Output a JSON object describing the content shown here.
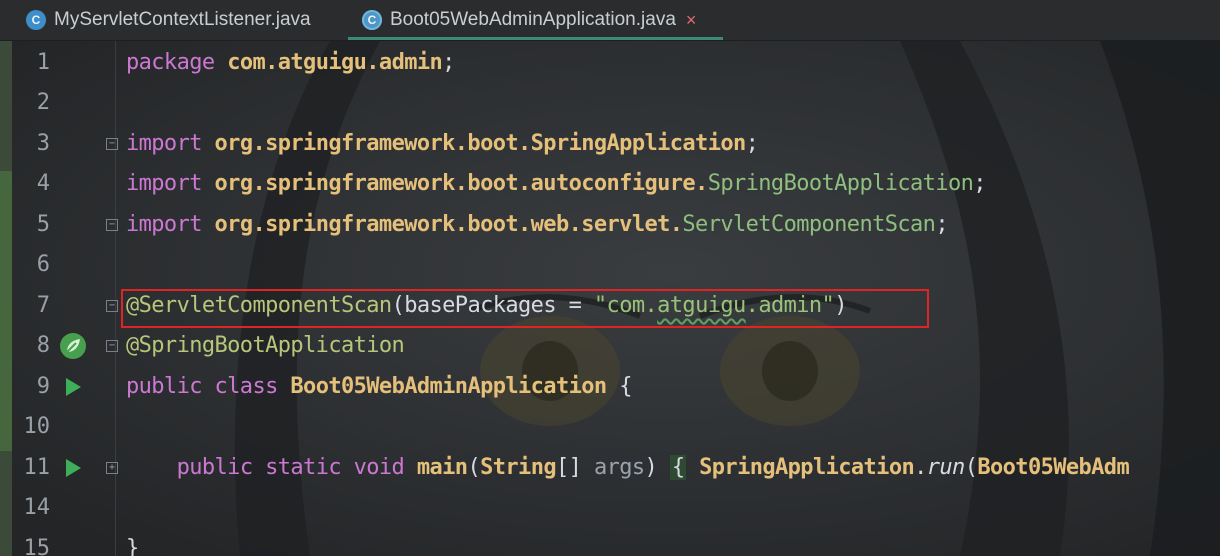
{
  "tabs": [
    {
      "icon": "class-c-icon",
      "icon_glyph": "C",
      "label": "MyServletContextListener.java",
      "active": false
    },
    {
      "icon": "spring-boot-class-icon",
      "icon_glyph": "C",
      "label": "Boot05WebAdminApplication.java",
      "active": true
    }
  ],
  "close_glyph": "×",
  "colors": {
    "keyword": "#cc78d3",
    "package": "#e5c07b",
    "class_ref": "#8fbf7f",
    "string": "#98c379",
    "highlight_box": "#e02424",
    "run_icon": "#3fae5a"
  },
  "editor": {
    "lines": [
      {
        "num": "1",
        "parts": [
          "package",
          " ",
          "com.atguigu.admin",
          ";"
        ]
      },
      {
        "num": "2",
        "parts": []
      },
      {
        "num": "3",
        "parts": [
          "import",
          " ",
          "org.springframework.boot.SpringApplication",
          ";"
        ]
      },
      {
        "num": "4",
        "parts": [
          "import",
          " ",
          "org.springframework.boot.autoconfigure.",
          "SpringBootApplication",
          ";"
        ]
      },
      {
        "num": "5",
        "parts": [
          "import",
          " ",
          "org.springframework.boot.web.servlet.",
          "ServletComponentScan",
          ";"
        ]
      },
      {
        "num": "6",
        "parts": []
      },
      {
        "num": "7",
        "parts": [
          "@ServletComponentScan",
          "(",
          "basePackages",
          " = ",
          "\"com.",
          "atguigu",
          ".admin\"",
          ")"
        ]
      },
      {
        "num": "8",
        "parts": [
          "@SpringBootApplication"
        ]
      },
      {
        "num": "9",
        "parts": [
          "public class",
          " ",
          "Boot05WebAdminApplication",
          " {"
        ]
      },
      {
        "num": "10",
        "parts": []
      },
      {
        "num": "11",
        "parts": [
          "    ",
          "public static void",
          " ",
          "main",
          "(",
          "String",
          "[] ",
          "args",
          ") ",
          "{",
          " ",
          "SpringApplication",
          ".",
          "run",
          "(",
          "Boot05WebAdm"
        ]
      },
      {
        "num": "14",
        "parts": []
      },
      {
        "num": "15",
        "parts": [
          "}"
        ]
      }
    ]
  }
}
